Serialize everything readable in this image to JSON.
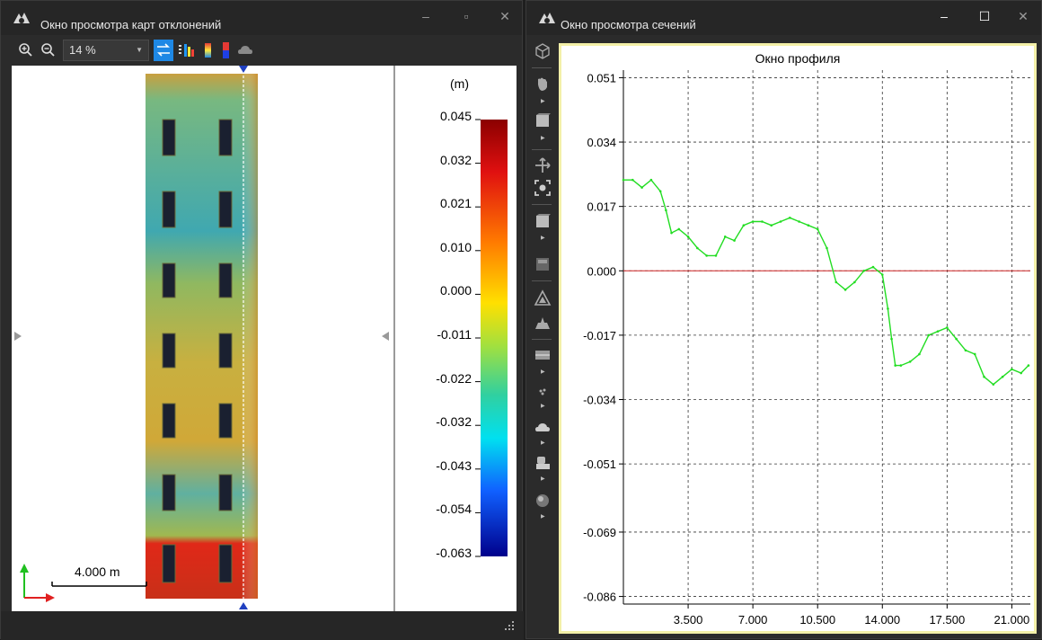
{
  "left_window": {
    "title": "Окно просмотра карт отклонений",
    "zoom_value": "14 %",
    "scale_bar_label": "4.000 m",
    "legend": {
      "unit": "(m)",
      "ticks": [
        "0.045",
        "0.032",
        "0.021",
        "0.010",
        "0.000",
        "-0.011",
        "-0.022",
        "-0.032",
        "-0.043",
        "-0.054",
        "-0.063"
      ]
    },
    "toolbar_icons": [
      "zoom-in-icon",
      "zoom-out-icon",
      "swap-icon",
      "histogram-icon",
      "color-scale-icon",
      "red-blue-scale-icon",
      "cloud-icon"
    ]
  },
  "right_window": {
    "title": "Окно просмотра сечений",
    "profile_title": "Окно профиля",
    "side_tools": [
      "cube-icon",
      "hand-icon",
      "box-icon",
      "move-icon",
      "fit-icon",
      "layer-icon",
      "stack-icon",
      "triangle-icon",
      "terrain-icon",
      "plane-icon",
      "points-icon",
      "cloud-icon",
      "scanner-icon",
      "sphere-icon"
    ],
    "colors": {
      "profile_line": "#22dd22",
      "zero_line": "#cc2222",
      "frame": "#f3f0a8"
    }
  },
  "chart_data": {
    "type": "line",
    "title": "Окно профиля",
    "xlabel": "",
    "ylabel": "",
    "x_ticks": [
      "3.500",
      "7.000",
      "10.500",
      "14.000",
      "17.500",
      "21.000"
    ],
    "y_ticks": [
      "0.051",
      "0.034",
      "0.017",
      "0.000",
      "-0.017",
      "-0.034",
      "-0.051",
      "-0.069",
      "-0.086"
    ],
    "xlim": [
      0.0,
      22.0
    ],
    "ylim": [
      -0.088,
      0.053
    ],
    "grid": true,
    "reference_line_y": 0.0,
    "series": [
      {
        "x": [
          0.0,
          0.5,
          1.0,
          1.5,
          2.0,
          2.3,
          2.6,
          3.0,
          3.5,
          4.0,
          4.5,
          5.0,
          5.5,
          6.0,
          6.5,
          7.0,
          7.5,
          8.0,
          8.5,
          9.0,
          9.5,
          10.0,
          10.5,
          11.0,
          11.5,
          12.0,
          12.5,
          13.0,
          13.5,
          14.0,
          14.3,
          14.5,
          14.7,
          15.0,
          15.5,
          16.0,
          16.5,
          17.0,
          17.5,
          18.0,
          18.5,
          19.0,
          19.5,
          20.0,
          20.5,
          21.0,
          21.5,
          21.9
        ],
        "y": [
          0.024,
          0.024,
          0.022,
          0.024,
          0.021,
          0.016,
          0.01,
          0.011,
          0.009,
          0.006,
          0.004,
          0.004,
          0.009,
          0.008,
          0.012,
          0.013,
          0.013,
          0.012,
          0.013,
          0.014,
          0.013,
          0.012,
          0.011,
          0.006,
          -0.003,
          -0.005,
          -0.003,
          0.0,
          0.001,
          -0.001,
          -0.01,
          -0.018,
          -0.025,
          -0.025,
          -0.024,
          -0.022,
          -0.017,
          -0.016,
          -0.015,
          -0.018,
          -0.021,
          -0.022,
          -0.028,
          -0.03,
          -0.028,
          -0.026,
          -0.027,
          -0.025
        ]
      }
    ]
  }
}
